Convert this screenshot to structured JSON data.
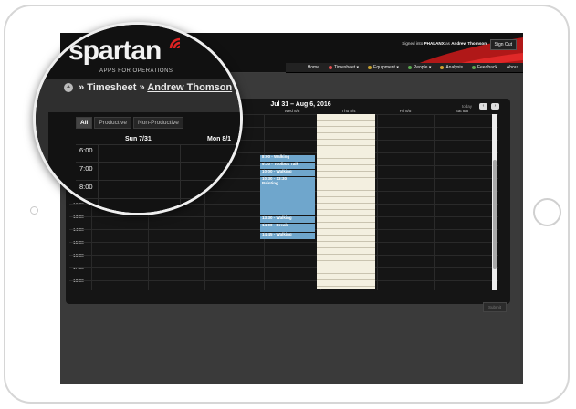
{
  "header": {
    "signed_in_prefix": "Signed into",
    "org": "PHALANX",
    "as_text": "as",
    "user": "Andrew Thomson",
    "signout": "Sign Out"
  },
  "nav": [
    {
      "label": "Home",
      "dot": null
    },
    {
      "label": "Timesheet ▾",
      "dot": "#e05050"
    },
    {
      "label": "Equipment ▾",
      "dot": "#c4a030"
    },
    {
      "label": "People ▾",
      "dot": "#5aa850"
    },
    {
      "label": "Analysis",
      "dot": "#d0a030"
    },
    {
      "label": "Feedback",
      "dot": "#60a050"
    },
    {
      "label": "About",
      "dot": null
    }
  ],
  "brand": {
    "name": "spartan",
    "tagline": "APPS FOR OPERATIONS"
  },
  "breadcrumb": {
    "section": "» Timesheet »",
    "person": "Andrew Thomson"
  },
  "calendar": {
    "range": "Jul 31 – Aug 6, 2016",
    "today": "today",
    "prev": "‹",
    "next": "›",
    "tabs": [
      "All",
      "Productive",
      "Non-Productive"
    ],
    "days_zoom": [
      "Sun 7/31",
      "Mon 8/1"
    ],
    "days": [
      "Wed 8/3",
      "Thu 8/4",
      "Fri 8/5",
      "Sat 8/6"
    ],
    "times_zoom": [
      "6:00",
      "7:00",
      "8:00"
    ],
    "times": [
      "11:00",
      "12:00",
      "13:00",
      "14:00",
      "15:00",
      "16:00",
      "17:00",
      "18:00"
    ],
    "events": [
      {
        "text": "8:00 - Walking"
      },
      {
        "text": "9:30 - Toolbox Talk"
      },
      {
        "text": "10:00 - Walking"
      },
      {
        "text": "10:30 - 13:30"
      },
      {
        "text": "Painting"
      },
      {
        "text": "13:30 - Walking"
      },
      {
        "text": "14:00 - Break"
      },
      {
        "text": "14:45 - Walking"
      }
    ],
    "submit": "Submit"
  }
}
